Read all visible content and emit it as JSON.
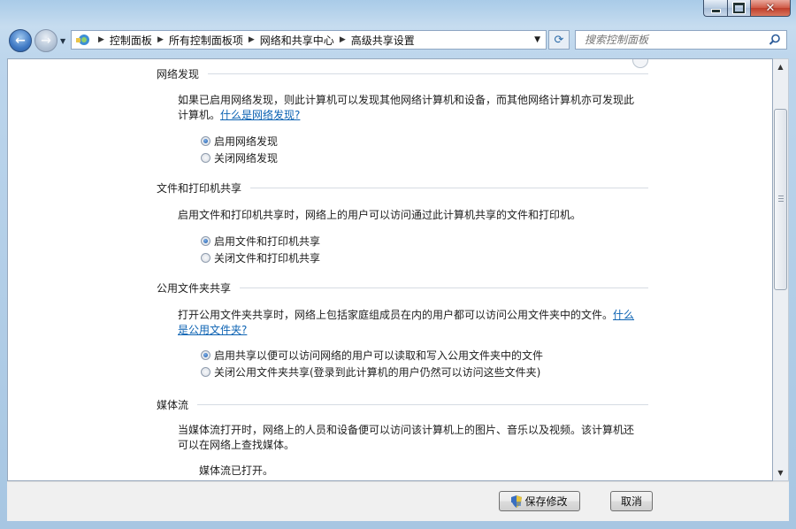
{
  "breadcrumb": [
    "控制面板",
    "所有控制面板项",
    "网络和共享中心",
    "高级共享设置"
  ],
  "search": {
    "placeholder": "搜索控制面板"
  },
  "sections": {
    "network_discovery": {
      "title": "网络发现",
      "desc": "如果已启用网络发现，则此计算机可以发现其他网络计算机和设备，而其他网络计算机亦可发现此计算机。",
      "link": "什么是网络发现?",
      "options": [
        "启用网络发现",
        "关闭网络发现"
      ],
      "selected": 0
    },
    "file_printer": {
      "title": "文件和打印机共享",
      "desc": "启用文件和打印机共享时，网络上的用户可以访问通过此计算机共享的文件和打印机。",
      "options": [
        "启用文件和打印机共享",
        "关闭文件和打印机共享"
      ],
      "selected": 0
    },
    "public_folder": {
      "title": "公用文件夹共享",
      "desc": "打开公用文件夹共享时，网络上包括家庭组成员在内的用户都可以访问公用文件夹中的文件。",
      "link_a": "什么",
      "link_b": "是公用文件夹?",
      "options": [
        "启用共享以便可以访问网络的用户可以读取和写入公用文件夹中的文件",
        "关闭公用文件夹共享(登录到此计算机的用户仍然可以访问这些文件夹)"
      ],
      "selected": 0
    },
    "media": {
      "title": "媒体流",
      "desc_line1": "当媒体流打开时，网络上的人员和设备便可以访问该计算机上的图片、音乐以及视频。该计算机还",
      "desc_line2": "可以在网络上查找媒体。",
      "status": "媒体流已打开。"
    }
  },
  "buttons": {
    "save": "保存修改",
    "cancel": "取消"
  },
  "colors": {
    "link": "#0d63b3",
    "frame": "#bcd5ec"
  }
}
